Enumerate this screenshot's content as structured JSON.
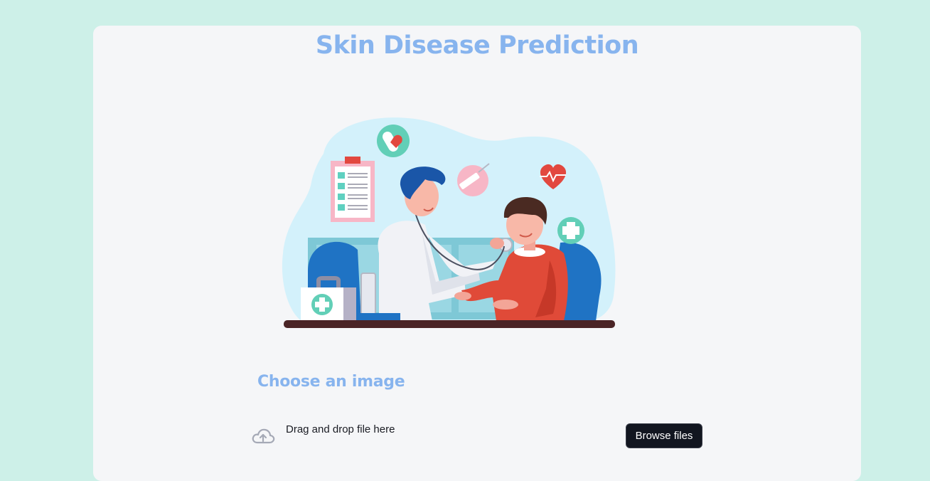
{
  "page": {
    "title": "Skin Disease Prediction"
  },
  "illustration": {
    "icon": "doctor-patient-illustration"
  },
  "uploader": {
    "section_title": "Choose an image",
    "drop_text": "Drag and drop file here",
    "limit_text": "",
    "browse_label": "Browse files",
    "icon": "cloud-upload-icon"
  },
  "colors": {
    "app_background": "#cdf0e8",
    "card_background": "#f5f6f8",
    "accent_title": "#87b4ee",
    "button_background": "#121620",
    "button_text": "#ffffff"
  }
}
